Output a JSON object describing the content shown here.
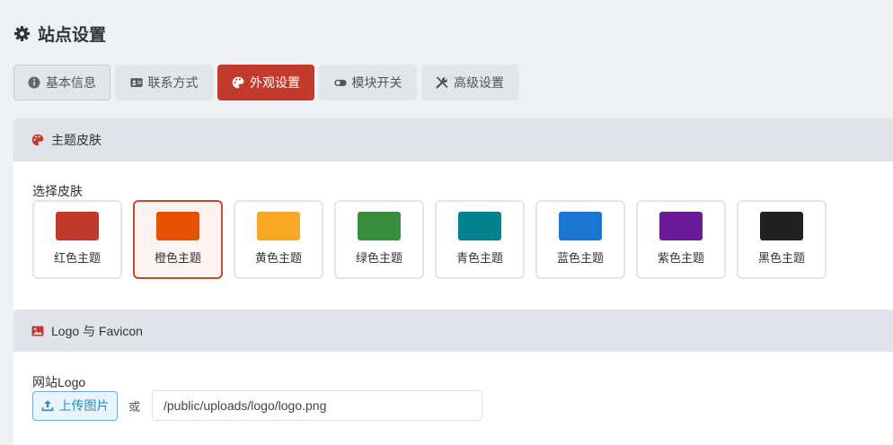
{
  "page": {
    "title": "站点设置",
    "icon": "gear-icon"
  },
  "tabs": [
    {
      "label": "基本信息",
      "icon": "info-circle-icon"
    },
    {
      "label": "联系方式",
      "icon": "id-card-icon"
    },
    {
      "label": "外观设置",
      "icon": "palette-icon",
      "active": true
    },
    {
      "label": "模块开关",
      "icon": "toggle-icon"
    },
    {
      "label": "高级设置",
      "icon": "tools-icon"
    }
  ],
  "theme_section": {
    "title": "主题皮肤",
    "icon": "palette-icon",
    "field_label": "选择皮肤",
    "skins": [
      {
        "name": "红色主题",
        "color": "#c0392b"
      },
      {
        "name": "橙色主题",
        "color": "#e65100",
        "selected": true
      },
      {
        "name": "黄色主题",
        "color": "#f9a825"
      },
      {
        "name": "绿色主题",
        "color": "#388e3c"
      },
      {
        "name": "青色主题",
        "color": "#00838f"
      },
      {
        "name": "蓝色主题",
        "color": "#1976d2"
      },
      {
        "name": "紫色主题",
        "color": "#6a1b9a"
      },
      {
        "name": "黑色主题",
        "color": "#212121"
      }
    ]
  },
  "logo_section": {
    "title": "Logo 与 Favicon",
    "icon": "image-icon",
    "field_label": "网站Logo",
    "upload_label": "上传图片",
    "or_text": "或",
    "path_value": "/public/uploads/logo/logo.png"
  },
  "colors": {
    "accent": "#c23a2e",
    "selected_border": "#c64a2c",
    "upload_blue": "#2e8ac8"
  }
}
